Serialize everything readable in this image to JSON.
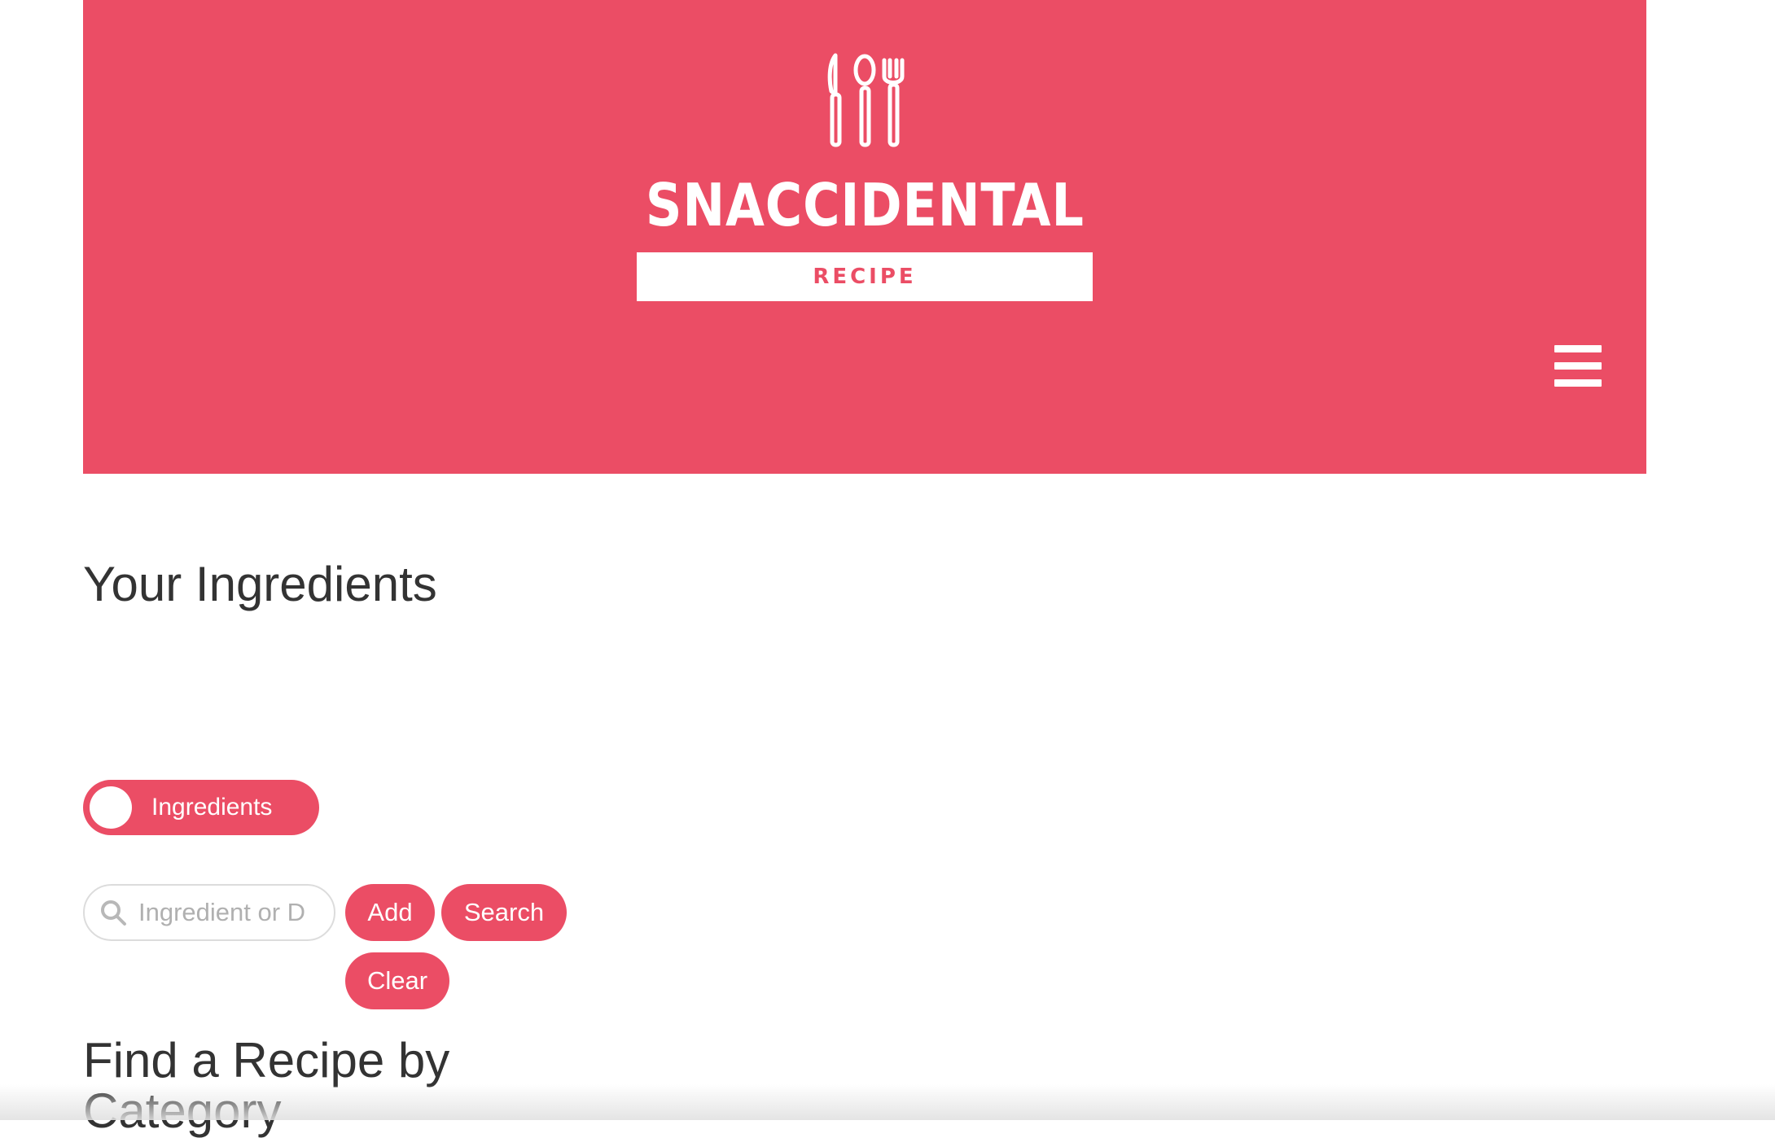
{
  "brand": {
    "name": "SNACCIDENTAL",
    "tagline": "RECIPE",
    "logo_icon": "cutlery-icon",
    "color": "#eb4d65"
  },
  "nav": {
    "menu_icon": "hamburger-menu-icon"
  },
  "ingredients_section": {
    "title": "Your Ingredients",
    "toggle_label": "Ingredients",
    "search_placeholder": "Ingredient or D",
    "search_value": "",
    "add_label": "Add",
    "search_label": "Search",
    "clear_label": "Clear"
  },
  "category_section": {
    "title": "Find a Recipe by Category"
  }
}
